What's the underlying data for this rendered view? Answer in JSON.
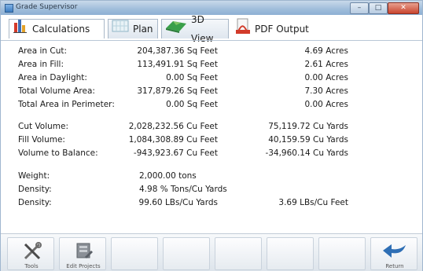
{
  "window": {
    "title": "Grade Supervisor"
  },
  "tabs": [
    {
      "label": "Calculations",
      "icon": "bar-chart-icon",
      "active": true
    },
    {
      "label": "Plan",
      "icon": "plan-grid-icon",
      "active": false
    },
    {
      "label": "3D View",
      "icon": "terrain-3d-icon",
      "active": false
    },
    {
      "label": "PDF Output",
      "icon": "pdf-document-icon",
      "active": false
    }
  ],
  "calculations": {
    "areas": [
      {
        "label": "Area in Cut:",
        "value1": "204,387.36 Sq Feet",
        "value2": "4.69 Acres"
      },
      {
        "label": "Area in Fill:",
        "value1": "113,491.91 Sq Feet",
        "value2": "2.61 Acres"
      },
      {
        "label": "Area in Daylight:",
        "value1": "0.00 Sq Feet",
        "value2": "0.00 Acres"
      },
      {
        "label": "Total Volume Area:",
        "value1": "317,879.26 Sq Feet",
        "value2": "7.30 Acres"
      },
      {
        "label": "Total Area in Perimeter:",
        "value1": "0.00 Sq Feet",
        "value2": "0.00 Acres"
      }
    ],
    "volumes": [
      {
        "label": "Cut Volume:",
        "value1": "2,028,232.56 Cu Feet",
        "value2": "75,119.72 Cu Yards"
      },
      {
        "label": "Fill Volume:",
        "value1": "1,084,308.89 Cu Feet",
        "value2": "40,159.59 Cu Yards"
      },
      {
        "label": "Volume to Balance:",
        "value1": "-943,923.67 Cu Feet",
        "value2": "-34,960.14 Cu Yards"
      }
    ],
    "weight": {
      "label": "Weight:",
      "value": "2,000.00 tons"
    },
    "density1": {
      "label": "Density:",
      "value": "4.98 % Tons/Cu Yards"
    },
    "density2": {
      "label": "Density:",
      "value1": "99.60 LBs/Cu Yards",
      "value2": "3.69 LBs/Cu Feet"
    }
  },
  "toolbar": {
    "tools_label": "Tools",
    "edit_projects_label": "Edit Projects",
    "return_label": "Return"
  },
  "colors": {
    "title_bar": "#9fbddb",
    "close_button": "#c9442e",
    "return_arrow": "#2f6fb5"
  }
}
